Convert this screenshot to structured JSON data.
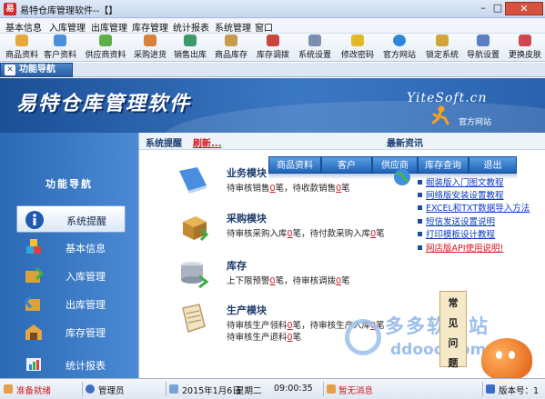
{
  "window": {
    "title": "易特仓库管理软件--【】"
  },
  "menu": [
    "基本信息",
    "入库管理",
    "出库管理",
    "库存管理",
    "统计报表",
    "系统管理",
    "窗口"
  ],
  "toolbar": [
    {
      "label": "商品资料",
      "icon": "goods-icon"
    },
    {
      "label": "客户资料",
      "icon": "customer-icon"
    },
    {
      "label": "供应商资料",
      "icon": "supplier-icon"
    },
    {
      "label": "采购进货",
      "icon": "purchase-icon"
    },
    {
      "label": "销售出库",
      "icon": "sales-icon"
    },
    {
      "label": "商品库存",
      "icon": "inventory-icon"
    },
    {
      "label": "库存调拨",
      "icon": "transfer-icon"
    },
    {
      "label": "系统设置",
      "icon": "settings-icon"
    },
    {
      "label": "修改密码",
      "icon": "key-icon"
    },
    {
      "label": "官方网站",
      "icon": "ie-icon"
    },
    {
      "label": "锁定系统",
      "icon": "lock-icon"
    },
    {
      "label": "导航设置",
      "icon": "nav-settings-icon"
    },
    {
      "label": "更换皮肤",
      "icon": "skin-icon"
    }
  ],
  "nav_tab": {
    "label": "功能导航"
  },
  "banner": {
    "title": "易特仓库管理软件",
    "site": "YiteSoft.cn",
    "official_link": "官方网站"
  },
  "left_panel": {
    "title": "功能导航",
    "items": [
      {
        "label": "系统提醒",
        "active": true
      },
      {
        "label": "基本信息"
      },
      {
        "label": "入库管理"
      },
      {
        "label": "出库管理"
      },
      {
        "label": "库存管理"
      },
      {
        "label": "统计报表"
      }
    ]
  },
  "content": {
    "header_reminder": "系统提醒",
    "header_refresh": "刷新...",
    "header_news": "最新资讯",
    "modules": [
      {
        "title": "业务模块",
        "lines": [
          [
            "待审核销售",
            "0",
            "笔，待收款销售",
            "0",
            "笔"
          ]
        ]
      },
      {
        "title": "采购模块",
        "lines": [
          [
            "待审核采购入库",
            "0",
            "笔，待付款采购入库",
            "0",
            "笔"
          ]
        ]
      },
      {
        "title": "库存",
        "lines": [
          [
            "上下限预警",
            "0",
            "笔，待审核调拨",
            "0",
            "笔"
          ]
        ]
      },
      {
        "title": "生产模块",
        "lines": [
          [
            "待审核生产领料",
            "0",
            "笔，待审核生产入库",
            "0",
            "笔"
          ],
          [
            "待审核生产退料",
            "0",
            "笔"
          ]
        ]
      }
    ],
    "quick_tabs": [
      "商品资料",
      "客户",
      "供应商",
      "库存查询",
      "退出"
    ],
    "news": [
      {
        "text": "掘装版入门图文教程",
        "red": false
      },
      {
        "text": "网络版安装设置教程",
        "red": false
      },
      {
        "text": "EXCEL和TXT数据导入方法",
        "red": false
      },
      {
        "text": "短信发送设置说明",
        "red": false
      },
      {
        "text": "打印模板设计教程",
        "red": false
      },
      {
        "text": "网店版API使用说明!",
        "red": true
      }
    ],
    "faq_tab": [
      "常",
      "见",
      "问",
      "题"
    ],
    "watermark": {
      "cn": "多多软件站",
      "en": "ddooo.com"
    }
  },
  "status": {
    "ready": "准备就绪",
    "user": "管理员",
    "date": "2015年1月6日",
    "weekday": "星期二",
    "time": "09:00:35",
    "message": "暂无消息",
    "version_label": "版本号：1"
  },
  "colors": {
    "accent": "#2a5fa6",
    "alert": "#d0161c",
    "link": "#0a3cc2"
  }
}
